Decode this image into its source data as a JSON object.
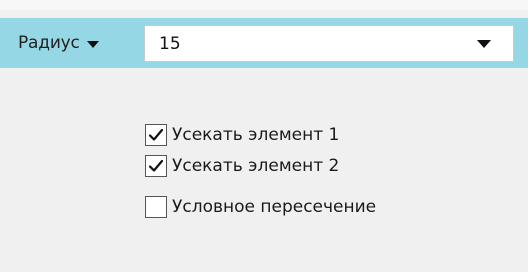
{
  "radius": {
    "label": "Радиус",
    "value": "15"
  },
  "options": [
    {
      "label": "Усекать элемент 1",
      "checked": true
    },
    {
      "label": "Усекать элемент 2",
      "checked": true
    },
    {
      "label": "Условное пересечение",
      "checked": false
    }
  ]
}
